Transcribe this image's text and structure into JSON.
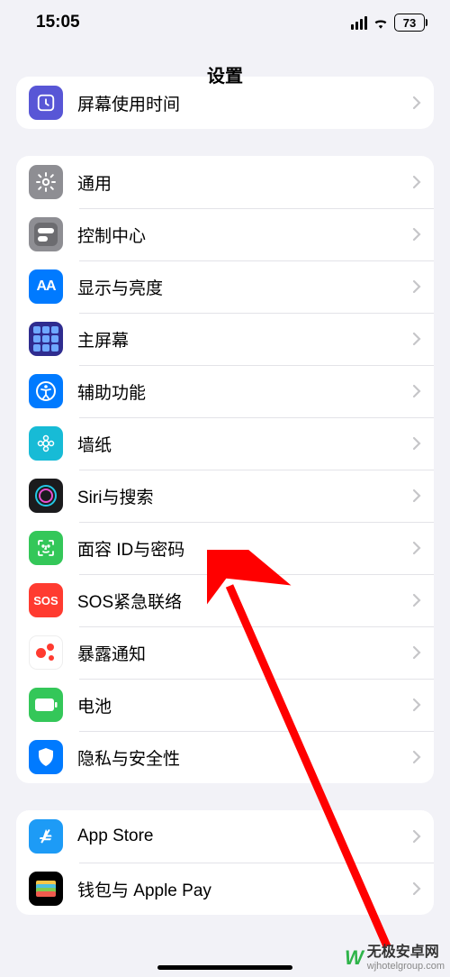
{
  "status": {
    "time": "15:05",
    "battery_pct": "73"
  },
  "header": {
    "title": "设置"
  },
  "group_partial": {
    "items": [
      {
        "label": "屏幕使用时间",
        "icon": "screentime-icon"
      }
    ]
  },
  "group1": {
    "items": [
      {
        "label": "通用",
        "icon": "general-icon"
      },
      {
        "label": "控制中心",
        "icon": "control-center-icon"
      },
      {
        "label": "显示与亮度",
        "icon": "display-icon"
      },
      {
        "label": "主屏幕",
        "icon": "home-screen-icon"
      },
      {
        "label": "辅助功能",
        "icon": "accessibility-icon"
      },
      {
        "label": "墙纸",
        "icon": "wallpaper-icon"
      },
      {
        "label": "Siri与搜索",
        "icon": "siri-icon"
      },
      {
        "label": "面容 ID与密码",
        "icon": "faceid-icon"
      },
      {
        "label": "SOS紧急联络",
        "icon": "sos-icon"
      },
      {
        "label": "暴露通知",
        "icon": "exposure-icon"
      },
      {
        "label": "电池",
        "icon": "battery-icon"
      },
      {
        "label": "隐私与安全性",
        "icon": "privacy-icon"
      }
    ]
  },
  "group2": {
    "items": [
      {
        "label": "App Store",
        "icon": "appstore-icon"
      },
      {
        "label": "钱包与 Apple Pay",
        "icon": "wallet-icon"
      }
    ]
  },
  "icon_text": {
    "display": "AA",
    "sos": "SOS"
  },
  "watermark": {
    "line1": "无极安卓网",
    "line2": "wjhotelgroup.com",
    "logo": "W"
  },
  "annotation": {
    "arrow_color": "#ff0000"
  }
}
